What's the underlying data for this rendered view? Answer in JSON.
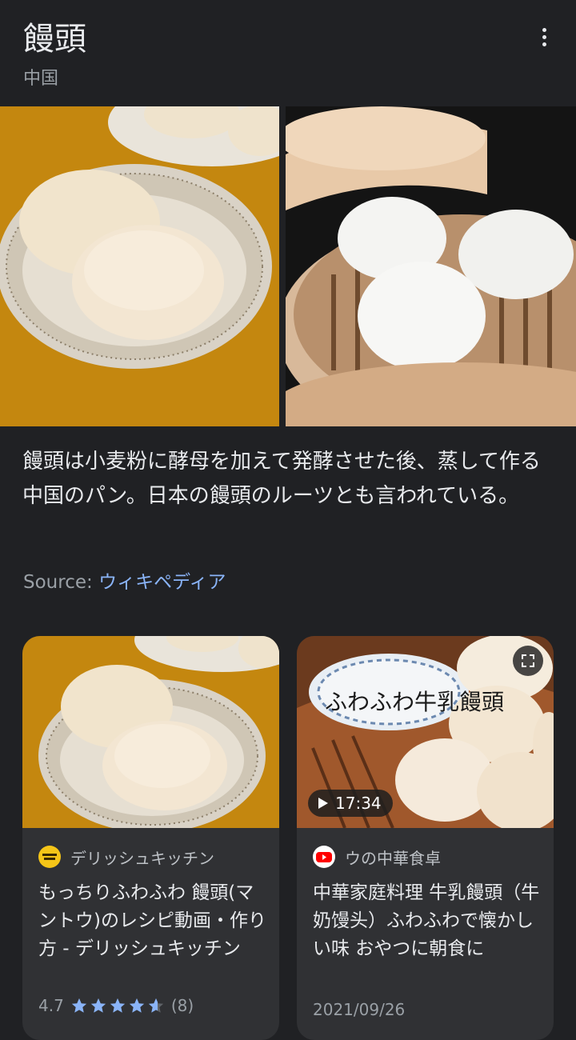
{
  "header": {
    "title": "饅頭",
    "subtitle": "中国"
  },
  "description": "饅頭は小麦粉に酵母を加えて発酵させた後、蒸して作る中国のパン。日本の饅頭のルーツとも言われている。",
  "source": {
    "label": "Source:",
    "link_text": "ウィキペディア"
  },
  "cards": [
    {
      "site_name": "デリッシュキッチン",
      "site_icon_text": "デリッシュキッチン",
      "title": "もっちりふわふわ 饅頭(マントウ)のレシピ動画・作り方 - デリッシュキッチン",
      "rating": "4.7",
      "rating_value": 4.7,
      "review_count": "(8)"
    },
    {
      "site_name": "ウの中華食卓",
      "title": "中華家庭料理 牛乳饅頭（牛奶馒头）ふわふわで懐かしい味 おやつに朝食に",
      "date": "2021/09/26",
      "duration": "17:34",
      "overlay_text": "ふわふわ牛乳饅頭"
    }
  ],
  "colors": {
    "background": "#202124",
    "card": "#303134",
    "link": "#8ab4f8",
    "star": "#8ab4f8",
    "youtube": "#ff0000",
    "delish": "#f5c518"
  }
}
